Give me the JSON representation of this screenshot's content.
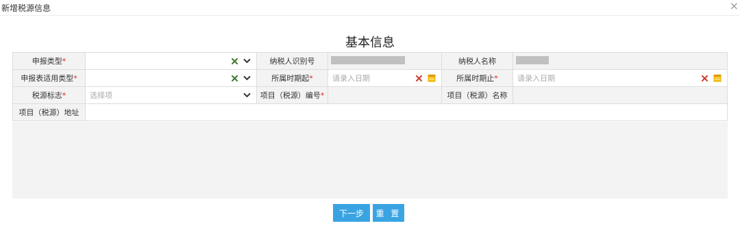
{
  "dialog": {
    "title": "新增税源信息",
    "close_label": "×"
  },
  "section": {
    "title": "基本信息"
  },
  "form": {
    "required_mark": "*",
    "row1": {
      "declare_type_label": "申报类型",
      "declare_type_value": "",
      "taxpayer_id_label": "纳税人识别号",
      "taxpayer_name_label": "纳税人名称"
    },
    "row2": {
      "form_type_label": "申报表适用类型",
      "form_type_value": "",
      "period_start_label": "所属时期起",
      "period_start_placeholder": "请录入日期",
      "period_end_label": "所属时期止",
      "period_end_placeholder": "请录入日期"
    },
    "row3": {
      "tax_flag_label": "税源标志",
      "tax_flag_placeholder": "选择项",
      "project_no_label": "项目（税源）编号",
      "project_name_label": "项目（税源）名称"
    },
    "row4": {
      "project_address_label": "项目（税源）地址"
    }
  },
  "buttons": {
    "next": "下一步",
    "reset": "重 置"
  },
  "colors": {
    "accent": "#3aa4e3",
    "required": "#e02020",
    "clear_green": "#3c7a2e",
    "clear_red": "#d23c2c",
    "calendar": "#f0b400"
  },
  "icons": [
    "close-icon",
    "clear-icon",
    "chevron-down-icon",
    "calendar-icon"
  ]
}
